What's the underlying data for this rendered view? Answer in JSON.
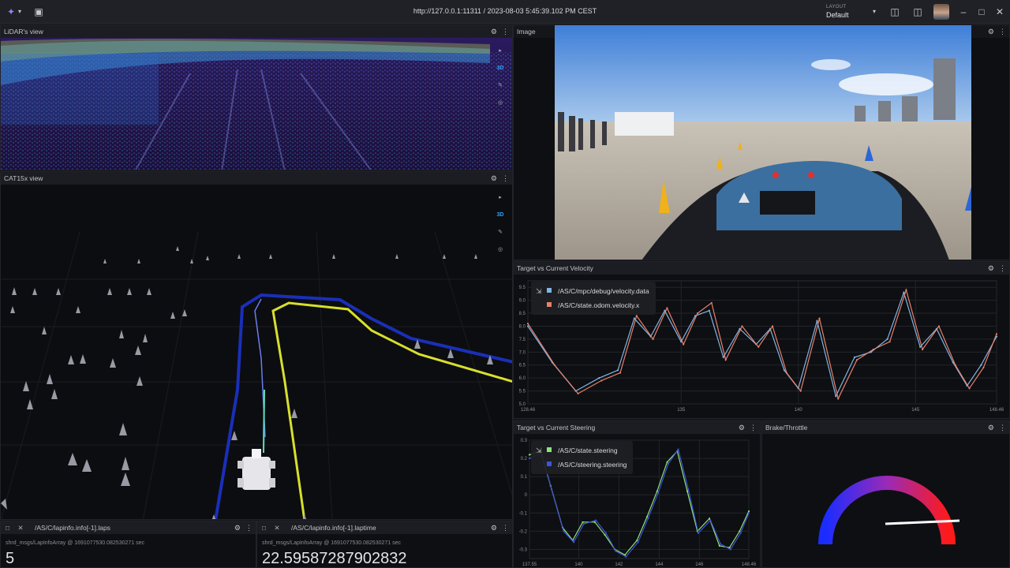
{
  "topbar": {
    "url": "http://127.0.0.1:11311 / 2023-08-03 5:45:39.102 PM CEST",
    "layout_label": "LAYOUT",
    "layout_value": "Default"
  },
  "panels": {
    "lidar": {
      "title": "LiDAR's view",
      "mode": "3D"
    },
    "cat": {
      "title": "CAT15x view",
      "mode": "3D"
    },
    "image": {
      "title": "Image"
    },
    "velocity": {
      "title": "Target vs Current Velocity",
      "series": [
        "/AS/C/mpc/debug/velocity.data",
        "/AS/C/state.odom.velocity.x"
      ],
      "colors": [
        "#7fb6e6",
        "#e8806a"
      ]
    },
    "steering": {
      "title": "Target vs Current Steering",
      "series": [
        "/AS/C/state.steering",
        "/AS/C/steering.steering"
      ],
      "colors": [
        "#8ee37a",
        "#3f54d8"
      ]
    },
    "brake": {
      "title": "Brake/Throttle"
    },
    "laps": {
      "title": "/AS/C/lapinfo.info[-1].laps",
      "meta": "shrd_msgs/LapInfoArray @ 1691077530.082530271 sec",
      "value": "5"
    },
    "laptime": {
      "title": "/AS/C/lapinfo.info[-1].laptime",
      "meta": "shrd_msgs/LapInfoArray @ 1691077530.082530271 sec",
      "value": "22.59587287902832"
    }
  },
  "chart_data": [
    {
      "type": "line",
      "title": "Target vs Current Velocity",
      "x_ticks": [
        "128.46",
        "135",
        "140",
        "145",
        "148.46"
      ],
      "y_ticks": [
        "9.5",
        "9.0",
        "8.5",
        "8.0",
        "7.5",
        "7.0",
        "6.5",
        "6.0",
        "5.5",
        "5.0"
      ],
      "xlim": [
        128.46,
        148.46
      ],
      "ylim": [
        5.0,
        9.75
      ],
      "series": [
        {
          "name": "/AS/C/mpc/debug/velocity.data",
          "x": [
            128.46,
            129.5,
            130.5,
            131.5,
            132.3,
            133,
            133.7,
            134.3,
            135,
            135.6,
            136.2,
            136.8,
            137.5,
            138.2,
            138.8,
            139.4,
            140,
            140.8,
            141.6,
            142.4,
            143.1,
            143.8,
            144.5,
            145.2,
            145.9,
            146.6,
            147.2,
            147.8,
            148.46
          ],
          "y": [
            8.0,
            6.6,
            5.5,
            6.0,
            6.3,
            8.3,
            7.6,
            8.6,
            7.4,
            8.4,
            8.6,
            6.8,
            7.9,
            7.3,
            7.9,
            6.3,
            5.6,
            8.2,
            5.3,
            6.8,
            7.0,
            7.5,
            9.3,
            7.2,
            7.9,
            6.6,
            5.7,
            6.5,
            7.6
          ]
        },
        {
          "name": "/AS/C/state.odom.velocity.x",
          "x": [
            128.46,
            129.6,
            130.6,
            131.6,
            132.4,
            133.1,
            133.8,
            134.4,
            135.1,
            135.7,
            136.3,
            136.9,
            137.6,
            138.3,
            138.9,
            139.5,
            140.1,
            140.9,
            141.7,
            142.5,
            143.2,
            143.9,
            144.6,
            145.3,
            146,
            146.7,
            147.3,
            147.9,
            148.46
          ],
          "y": [
            8.1,
            6.5,
            5.4,
            5.9,
            6.2,
            8.4,
            7.5,
            8.7,
            7.3,
            8.5,
            8.9,
            6.7,
            8.0,
            7.2,
            8.0,
            6.2,
            5.5,
            8.3,
            5.2,
            6.7,
            7.1,
            7.4,
            9.4,
            7.1,
            8.0,
            6.5,
            5.6,
            6.4,
            7.7
          ]
        }
      ]
    },
    {
      "type": "line",
      "title": "Target vs Current Steering",
      "x_ticks": [
        "137.55",
        "140",
        "142",
        "144",
        "146",
        "148.46"
      ],
      "y_ticks": [
        "0.3",
        "0.2",
        "0.1",
        "0",
        "-0.1",
        "-0.2",
        "-0.3"
      ],
      "xlim": [
        137.55,
        148.46
      ],
      "ylim": [
        -0.35,
        0.3
      ],
      "series": [
        {
          "name": "/AS/C/state.steering",
          "x": [
            137.55,
            138.1,
            138.6,
            139.2,
            139.7,
            140.2,
            140.8,
            141.3,
            141.8,
            142.3,
            142.9,
            143.4,
            143.9,
            144.4,
            144.9,
            145.4,
            145.9,
            146.5,
            147,
            147.5,
            148,
            148.46
          ],
          "y": [
            0.22,
            0.24,
            0.05,
            -0.18,
            -0.25,
            -0.15,
            -0.15,
            -0.22,
            -0.3,
            -0.33,
            -0.25,
            -0.12,
            0.02,
            0.18,
            0.24,
            0.02,
            -0.2,
            -0.13,
            -0.28,
            -0.29,
            -0.2,
            -0.09
          ]
        },
        {
          "name": "/AS/C/steering.steering",
          "x": [
            137.55,
            138.15,
            138.65,
            139.25,
            139.75,
            140.25,
            140.85,
            141.35,
            141.85,
            142.35,
            142.95,
            143.45,
            143.95,
            144.45,
            144.95,
            145.45,
            145.95,
            146.55,
            147.05,
            147.55,
            148.05,
            148.46
          ],
          "y": [
            0.2,
            0.23,
            0.03,
            -0.2,
            -0.26,
            -0.16,
            -0.14,
            -0.21,
            -0.31,
            -0.34,
            -0.26,
            -0.13,
            0.01,
            0.17,
            0.25,
            0.03,
            -0.21,
            -0.14,
            -0.27,
            -0.3,
            -0.21,
            -0.1
          ]
        }
      ]
    }
  ]
}
